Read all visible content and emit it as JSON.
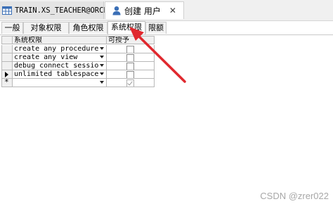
{
  "window_tabs": [
    {
      "label": "TRAIN.XS_TEACHER@ORCL",
      "icon": "table-icon"
    },
    {
      "label": "创建 用户",
      "icon": "user-icon",
      "close": "✕"
    }
  ],
  "sub_tabs": [
    "一般",
    "对象权限",
    "角色权限",
    "系统权限",
    "限额"
  ],
  "active_sub_tab": "系统权限",
  "grid": {
    "columns": [
      "系统权限",
      "可授予"
    ],
    "rows": [
      {
        "privilege": "create any procedure",
        "grantable": false
      },
      {
        "privilege": "create any view",
        "grantable": false
      },
      {
        "privilege": "debug connect sessio",
        "grantable": false
      },
      {
        "privilege": "unlimited tablespace",
        "grantable": false
      }
    ],
    "new_row_marker": "*"
  },
  "accent_color": "#e0282e",
  "watermark": "CSDN @zrer022"
}
